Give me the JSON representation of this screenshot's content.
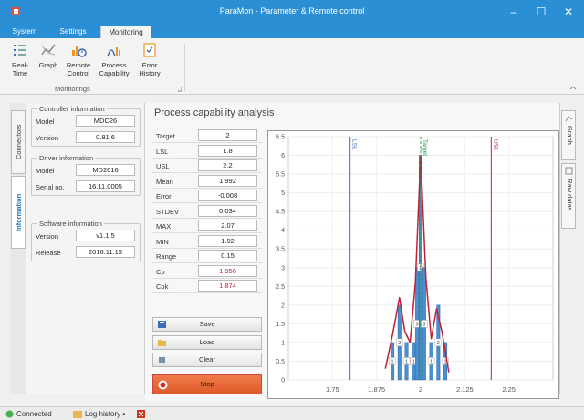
{
  "window": {
    "title": "ParaMon - Parameter & Remote control",
    "minimize": "–",
    "maximize": "☐",
    "close": "✕"
  },
  "menu": {
    "tabs": [
      "System",
      "Settings",
      "Monitoring"
    ],
    "active": "Monitoring"
  },
  "ribbon": {
    "buttons": [
      {
        "label": "Real-Time",
        "icon": "realtime-icon"
      },
      {
        "label": "Graph",
        "icon": "graph-icon"
      },
      {
        "label": "Remote\nControl",
        "icon": "remote-control-icon"
      },
      {
        "label": "Process\nCapability",
        "icon": "process-capability-icon"
      },
      {
        "label": "Error\nHistory",
        "icon": "error-history-icon"
      }
    ],
    "group_label": "Monitorings"
  },
  "left_tabs": {
    "connectors": "Connectors",
    "information": "Information"
  },
  "info": {
    "controller": {
      "title": "Controller information",
      "model_label": "Model",
      "model": "MDC26",
      "version_label": "Version",
      "version": "0.81.6"
    },
    "driver": {
      "title": "Driver information",
      "model_label": "Model",
      "model": "MD2616",
      "serial_label": "Serial no.",
      "serial": "16.11.0005"
    },
    "software": {
      "title": "Software information",
      "version_label": "Version",
      "version": "v1.1.5",
      "release_label": "Release",
      "release": "2016.11.15"
    }
  },
  "main": {
    "heading": "Process capability analysis"
  },
  "stats": [
    {
      "label": "Target",
      "value": "2"
    },
    {
      "label": "LSL",
      "value": "1.8"
    },
    {
      "label": "USL",
      "value": "2.2"
    },
    {
      "label": "Mean",
      "value": "1.992"
    },
    {
      "label": "Error",
      "value": "-0.008"
    },
    {
      "label": "STDEV",
      "value": "0.034"
    },
    {
      "label": "MAX",
      "value": "2.07"
    },
    {
      "label": "MIN",
      "value": "1.92"
    },
    {
      "label": "Range",
      "value": "0.15"
    },
    {
      "label": "Cp",
      "value": "1.956",
      "highlight": true
    },
    {
      "label": "Cpk",
      "value": "1.874",
      "highlight": true
    }
  ],
  "actions": {
    "save": "Save",
    "load": "Load",
    "clear": "Clear",
    "stop": "Stop"
  },
  "right_tabs": {
    "graph": "Graph",
    "raw": "Raw datas"
  },
  "status": {
    "connected": "Connected",
    "log": "Log history •"
  },
  "colors": {
    "accent": "#2b8fd6",
    "bar": "#4a8fd0",
    "curve": "#c0203a",
    "usl_line": "#c0203a",
    "lsl_line": "#3a6fb8",
    "target_line": "#2a9a4a"
  },
  "chart_data": {
    "type": "bar",
    "xlim": [
      1.625,
      2.375
    ],
    "ylim": [
      0,
      6.5
    ],
    "x_ticks": [
      1.75,
      1.875,
      2,
      2.125,
      2.25
    ],
    "y_ticks": [
      0,
      0.5,
      1,
      1.5,
      2,
      2.5,
      3,
      3.5,
      4,
      4.5,
      5,
      5.5,
      6,
      6.5
    ],
    "lines": [
      {
        "label": "LSL",
        "x": 1.8
      },
      {
        "label": "Target",
        "x": 2.0
      },
      {
        "label": "USL",
        "x": 2.2
      }
    ],
    "bars": [
      {
        "x": 1.92,
        "value": 1
      },
      {
        "x": 1.94,
        "value": 2
      },
      {
        "x": 1.96,
        "value": 1
      },
      {
        "x": 1.98,
        "value": 1
      },
      {
        "x": 1.99,
        "value": 3
      },
      {
        "x": 2.0,
        "value": 6
      },
      {
        "x": 2.01,
        "value": 3
      },
      {
        "x": 2.03,
        "value": 1
      },
      {
        "x": 2.05,
        "value": 2
      },
      {
        "x": 2.07,
        "value": 1
      }
    ],
    "curve": [
      [
        1.9,
        0.3
      ],
      [
        1.92,
        1.2
      ],
      [
        1.94,
        2.2
      ],
      [
        1.955,
        1.3
      ],
      [
        1.97,
        1.0
      ],
      [
        1.985,
        2.6
      ],
      [
        2.0,
        6.0
      ],
      [
        2.015,
        2.7
      ],
      [
        2.03,
        1.1
      ],
      [
        2.045,
        1.9
      ],
      [
        2.06,
        1.3
      ],
      [
        2.08,
        0.2
      ]
    ]
  }
}
